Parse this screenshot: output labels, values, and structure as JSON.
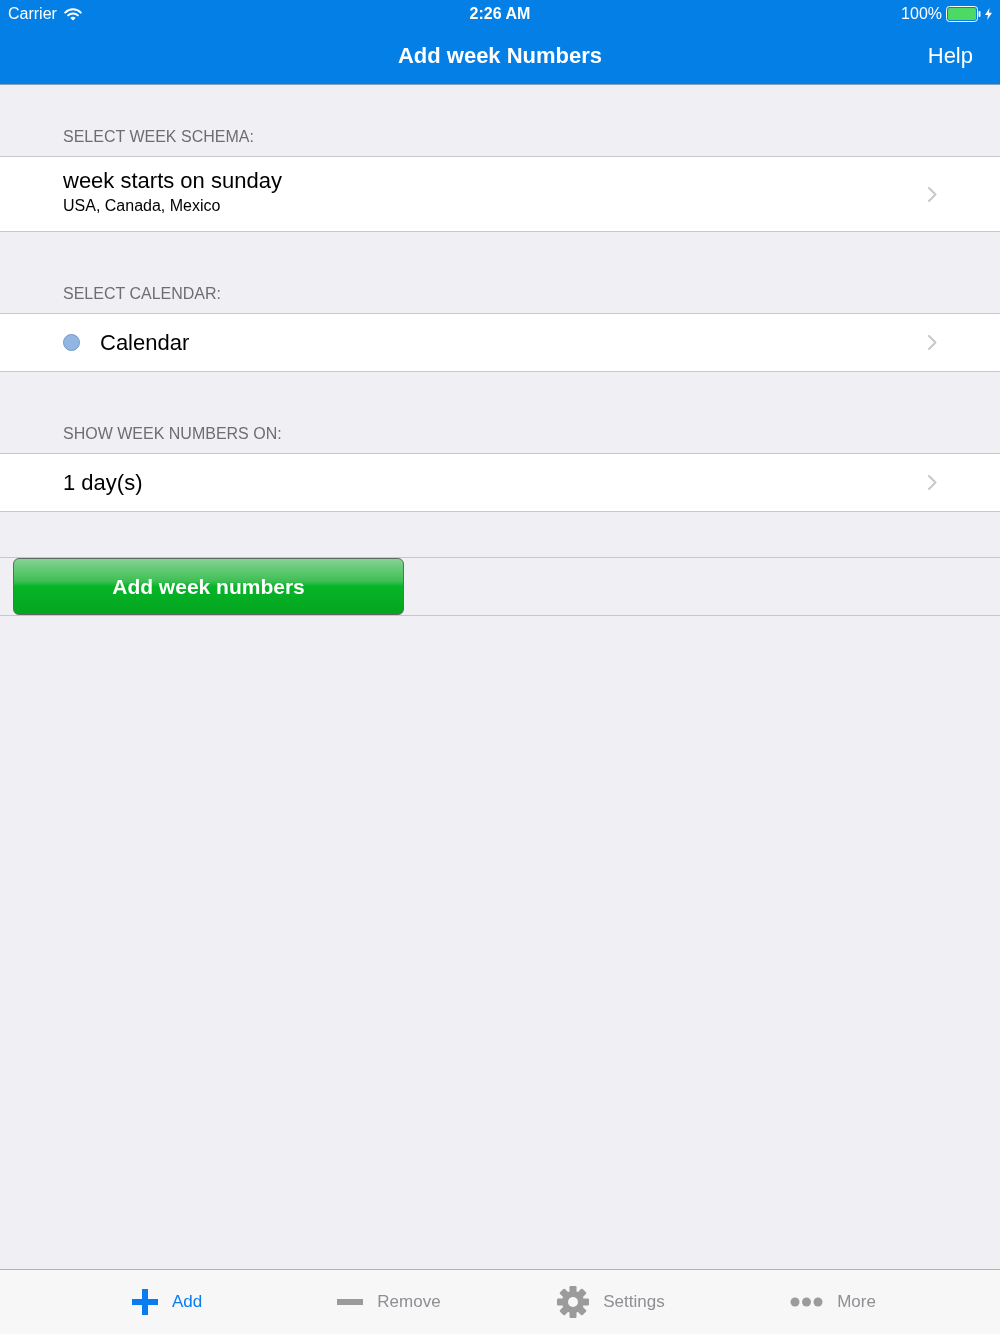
{
  "status_bar": {
    "carrier": "Carrier",
    "time": "2:26 AM",
    "battery": "100%"
  },
  "nav_bar": {
    "title": "Add week Numbers",
    "right_button": "Help"
  },
  "sections": [
    {
      "header": "SELECT WEEK SCHEMA:",
      "rows": [
        {
          "kind": "subtitle",
          "title": "week starts on sunday",
          "subtitle": "USA, Canada, Mexico"
        }
      ]
    },
    {
      "header": "SELECT CALENDAR:",
      "rows": [
        {
          "kind": "color",
          "title": "Calendar",
          "color": "#92b6e2"
        }
      ]
    },
    {
      "header": "SHOW WEEK NUMBERS ON:",
      "rows": [
        {
          "kind": "plain",
          "title": "1 day(s)"
        }
      ]
    }
  ],
  "action_button": {
    "label": "Add week numbers"
  },
  "tab_bar": [
    {
      "label": "Add",
      "selected": true
    },
    {
      "label": "Remove",
      "selected": false
    },
    {
      "label": "Settings",
      "selected": false
    },
    {
      "label": "More",
      "selected": false
    }
  ]
}
